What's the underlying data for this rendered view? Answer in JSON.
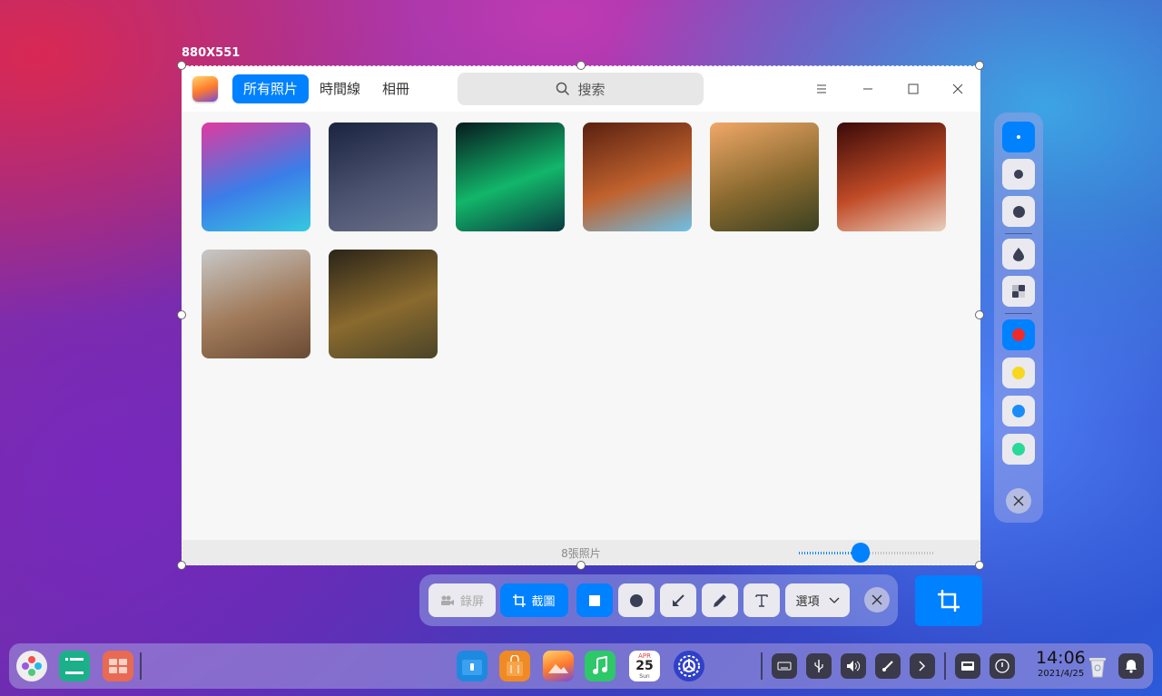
{
  "selection": {
    "size_label": "880X551"
  },
  "app": {
    "tabs": [
      {
        "label": "所有照片",
        "active": true
      },
      {
        "label": "時間線",
        "active": false
      },
      {
        "label": "相冊",
        "active": false
      }
    ],
    "search_placeholder": "搜索",
    "photos": [
      {
        "name": "deepin-wallpaper",
        "colors": [
          "#e03aa0",
          "#3b7de8",
          "#36c9e0"
        ]
      },
      {
        "name": "desert-night",
        "colors": [
          "#1a2340",
          "#4a5270",
          "#6c7088"
        ]
      },
      {
        "name": "aurora",
        "colors": [
          "#061a1e",
          "#12b66a",
          "#0a3a40"
        ]
      },
      {
        "name": "canyon-arch",
        "colors": [
          "#5a2010",
          "#c0622e",
          "#6cc0e8"
        ]
      },
      {
        "name": "mountain-sunset",
        "colors": [
          "#f0a868",
          "#8a6a30",
          "#3a4020"
        ]
      },
      {
        "name": "slot-canyon",
        "colors": [
          "#3a0a08",
          "#c04a26",
          "#e8d0c0"
        ]
      },
      {
        "name": "sand-dunes",
        "colors": [
          "#c8c8c8",
          "#a07a5a",
          "#6a4a34"
        ]
      },
      {
        "name": "forest",
        "colors": [
          "#2a2418",
          "#8a6a2e",
          "#4a4428"
        ]
      }
    ],
    "status_text": "8張照片",
    "zoom_fraction": 0.45
  },
  "side_panel": {
    "sizes": [
      "small",
      "medium",
      "large"
    ],
    "effects": [
      "blur-icon",
      "mosaic-icon"
    ],
    "colors": [
      "#f02a2a",
      "#f8d81e",
      "#1a8cf8",
      "#2ad89a"
    ],
    "active_color_index": 0
  },
  "toolbar": {
    "record_label": "錄屏",
    "screenshot_label": "截圖",
    "options_label": "選項"
  },
  "clock": {
    "time": "14:06",
    "date": "2021/4/25"
  },
  "calendar": {
    "month": "APR",
    "day": "25",
    "weekday": "Sun"
  }
}
